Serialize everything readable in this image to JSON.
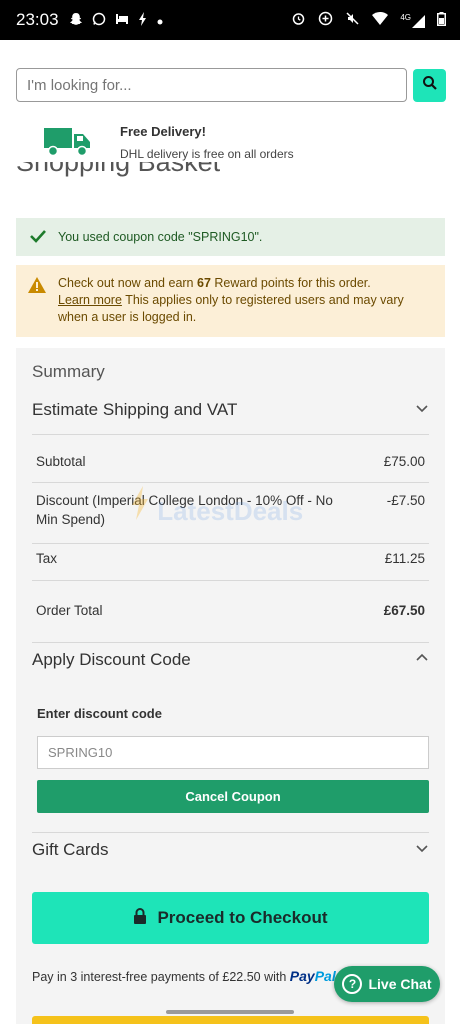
{
  "status_bar": {
    "time": "23:03",
    "network": "4G"
  },
  "search": {
    "placeholder": "I'm looking for..."
  },
  "delivery": {
    "title": "Free Delivery!",
    "subtitle": "DHL delivery is free on all orders"
  },
  "page": {
    "title": "Shopping Basket"
  },
  "alerts": {
    "success": "You used coupon code \"SPRING10\".",
    "warning_prefix": "Check out now and earn",
    "warning_points": "67",
    "warning_suffix": "Reward points for this order.",
    "learn_more": "Learn more",
    "warning_rest": "This applies only to registered users and may vary when a user is logged in."
  },
  "summary": {
    "title": "Summary",
    "shipping_label": "Estimate Shipping and VAT",
    "subtotal_label": "Subtotal",
    "subtotal_value": "£75.00",
    "discount_label": "Discount (Imperial College London - 10% Off - No Min Spend)",
    "discount_value": "-£7.50",
    "tax_label": "Tax",
    "tax_value": "£11.25",
    "total_label": "Order Total",
    "total_value": "£67.50",
    "discount_section_label": "Apply Discount Code",
    "discount_field_label": "Enter discount code",
    "discount_field_value": "SPRING10",
    "cancel_coupon_label": "Cancel Coupon",
    "gift_cards_label": "Gift Cards"
  },
  "checkout": {
    "label": "Proceed to Checkout"
  },
  "paypal": {
    "text": "Pay in 3 interest-free payments of £22.50 with",
    "brand_pay": "Pay",
    "brand_pal": "Pal"
  },
  "live_chat": {
    "label": "Live Chat"
  },
  "watermark": {
    "text": "LatestDeals"
  },
  "colors": {
    "accent": "#1ee4b8",
    "primary_green": "#1f9d6a",
    "success_bg": "#e5f0e6",
    "warning_bg": "#fcefd7",
    "summary_bg": "#f4f4f4"
  }
}
